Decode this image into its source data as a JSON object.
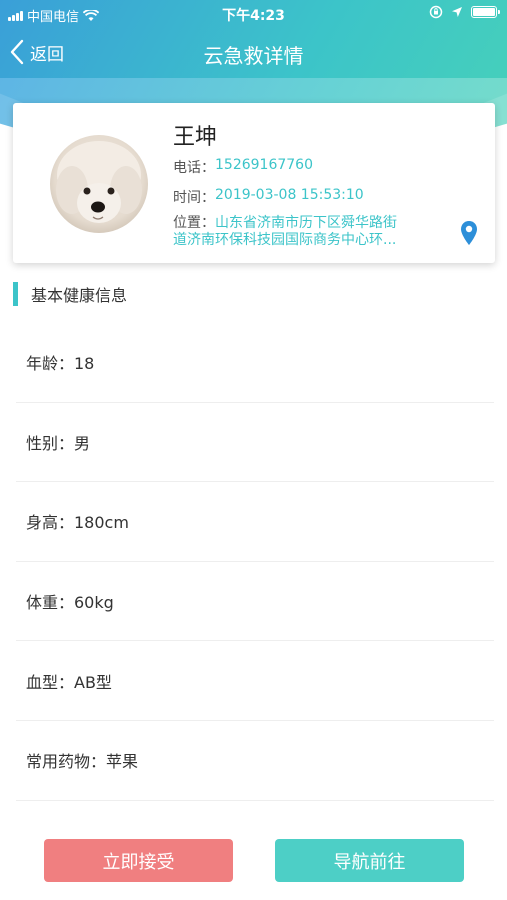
{
  "status_bar": {
    "carrier": "中国电信",
    "time": "下午4:23"
  },
  "nav": {
    "back_label": "返回",
    "title": "云急救详情"
  },
  "profile": {
    "name": "王坤",
    "phone_label": "电话：",
    "phone": "15269167760",
    "time_label": "时间：",
    "time": "2019-03-08 15:53:10",
    "address_label": "位置：",
    "address_line1": "山东省济南市历下区舜华路街",
    "address_line2": "道济南环保科技园国际商务中心环..."
  },
  "section": {
    "title": "基本健康信息"
  },
  "health": [
    {
      "text": "年龄：18"
    },
    {
      "text": "性别：男"
    },
    {
      "text": "身高：180cm"
    },
    {
      "text": "体重：60kg"
    },
    {
      "text": "血型：AB型"
    },
    {
      "text": "常用药物：苹果"
    }
  ],
  "actions": {
    "accept_label": "立即接受",
    "navigate_label": "导航前往"
  },
  "colors": {
    "accent": "#3cc4c9",
    "accept": "#f07f80",
    "navigate": "#4dcfc6"
  },
  "icons": [
    "signal-icon",
    "wifi-icon",
    "rotation-lock-icon",
    "location-arrow-icon",
    "battery-icon",
    "back-chevron-icon",
    "location-pin-icon"
  ]
}
